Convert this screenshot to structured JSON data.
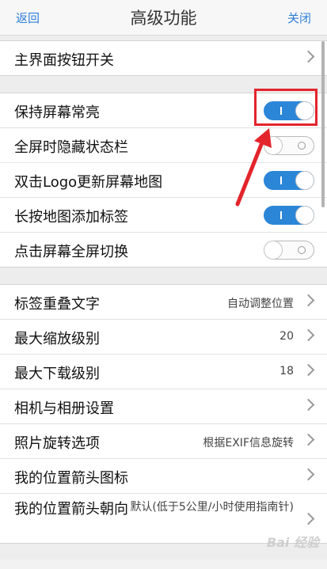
{
  "header": {
    "back_label": "返回",
    "title": "高级功能",
    "close_label": "关闭"
  },
  "group1": {
    "main_buttons_label": "主界面按钮开关"
  },
  "toggles": [
    {
      "label": "保持屏幕常亮",
      "state": "on"
    },
    {
      "label": "全屏时隐藏状态栏",
      "state": "off"
    },
    {
      "label": "双击Logo更新屏幕地图",
      "state": "on"
    },
    {
      "label": "长按地图添加标签",
      "state": "on"
    },
    {
      "label": "点击屏幕全屏切换",
      "state": "off"
    }
  ],
  "settings": [
    {
      "label": "标签重叠文字",
      "value": "自动调整位置"
    },
    {
      "label": "最大缩放级别",
      "value": "20"
    },
    {
      "label": "最大下载级别",
      "value": "18"
    },
    {
      "label": "相机与相册设置",
      "value": ""
    },
    {
      "label": "照片旋转选项",
      "value": "根据EXIF信息旋转"
    },
    {
      "label": "我的位置箭头图标",
      "value": ""
    },
    {
      "label": "我的位置箭头朝向",
      "value": "默认(低于5公里/小时使用指南针)"
    }
  ],
  "watermark": "Bai 经验",
  "colors": {
    "accent": "#2b86d8",
    "highlight": "#e3242b"
  }
}
